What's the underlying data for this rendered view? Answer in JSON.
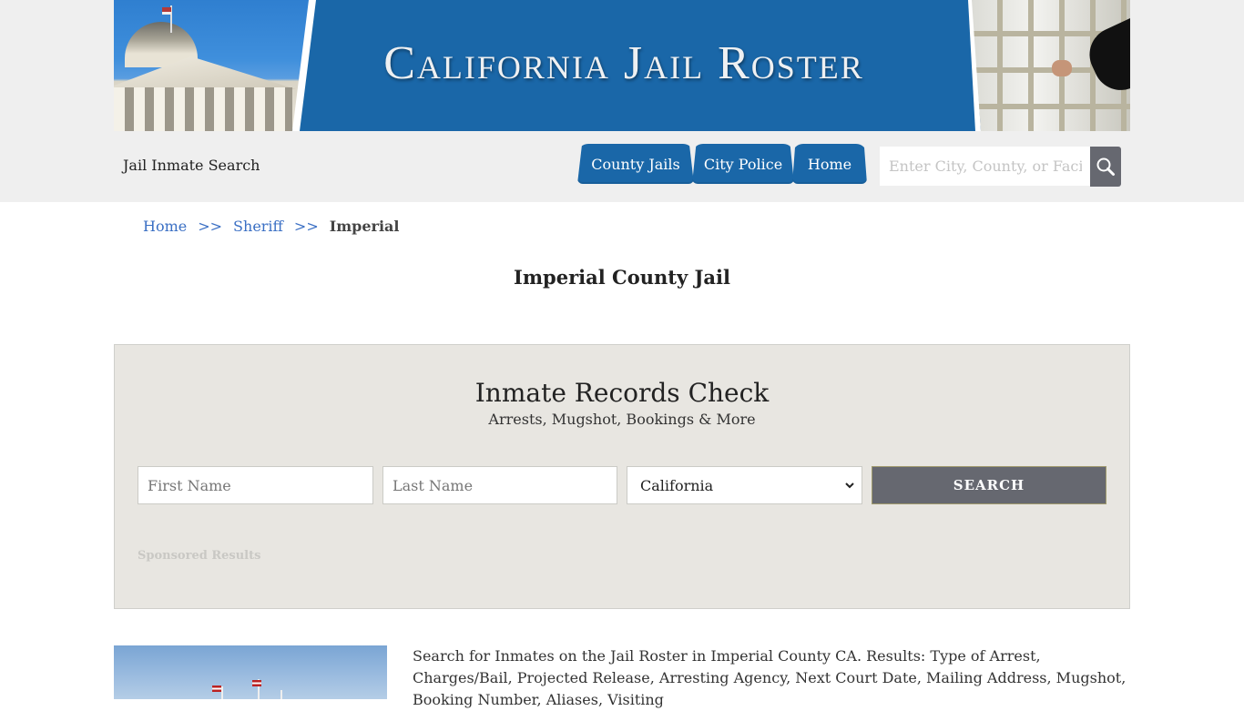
{
  "banner": {
    "title": "California Jail Roster"
  },
  "header": {
    "site_name": "Jail Inmate Search",
    "nav": [
      {
        "label": "County Jails"
      },
      {
        "label": "City Police"
      },
      {
        "label": "Home"
      }
    ],
    "search": {
      "placeholder": "Enter City, County, or Facility",
      "value": "",
      "icon": "search-icon"
    }
  },
  "breadcrumb": {
    "items": [
      {
        "label": "Home"
      },
      {
        "label": "Sheriff"
      }
    ],
    "separator": ">>",
    "current": "Imperial"
  },
  "page": {
    "title": "Imperial County Jail"
  },
  "records_check": {
    "title": "Inmate Records Check",
    "subtitle": "Arrests, Mugshot, Bookings & More",
    "first_name_placeholder": "First Name",
    "last_name_placeholder": "Last Name",
    "state_selected": "California",
    "search_label": "SEARCH",
    "sponsored_label": "Sponsored Results"
  },
  "content": {
    "description": "Search for Inmates on the Jail Roster in Imperial County CA. Results: Type of Arrest, Charges/Bail, Projected Release, Arresting Agency, Next Court Date, Mailing Address, Mugshot, Booking Number, Aliases, Visiting"
  },
  "colors": {
    "brand_blue": "#1a67a8",
    "link_blue": "#3a6fc4",
    "button_gray": "#666870",
    "panel_bg": "#e8e6e1",
    "header_bg": "#efefef"
  }
}
